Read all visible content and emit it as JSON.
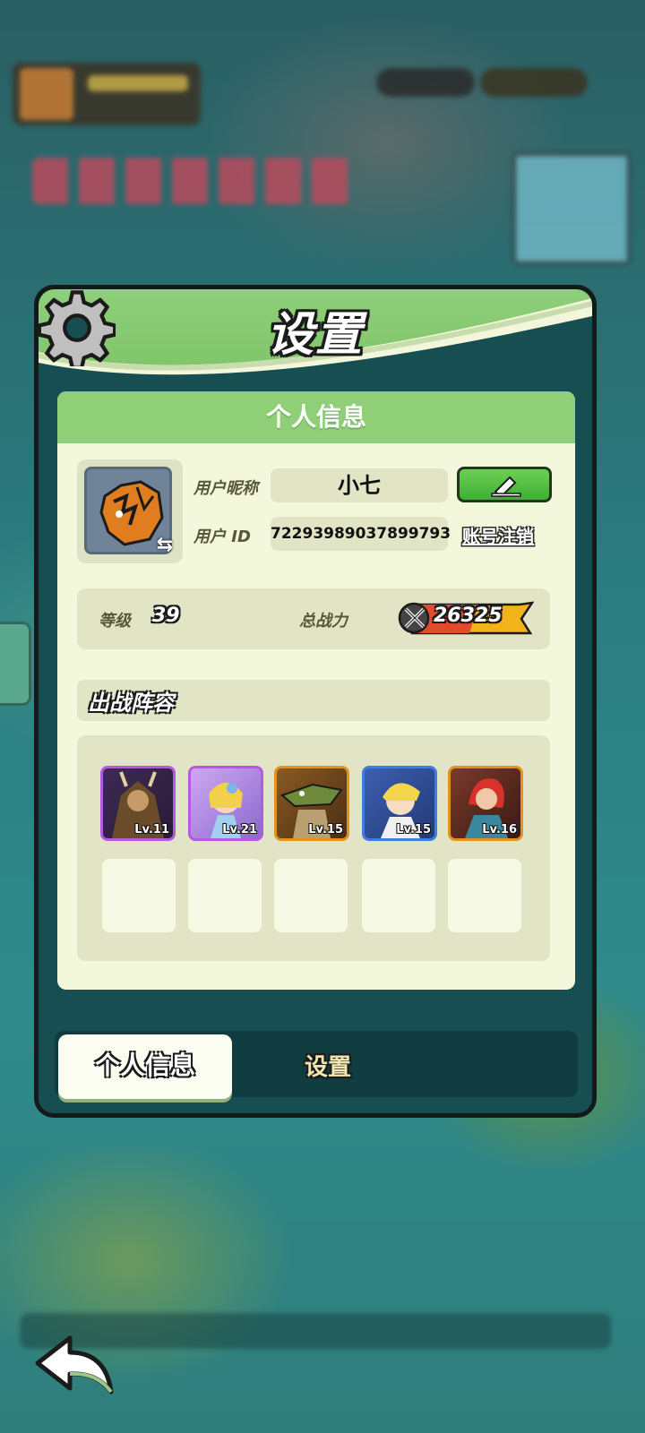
{
  "panel": {
    "title": "设置"
  },
  "profile": {
    "section_title": "个人信息",
    "nickname_label": "用户昵称",
    "nickname": "小七",
    "id_label": "用户 ID",
    "user_id": "72293989037899793",
    "delete_account": "账号注销",
    "level_label": "等级",
    "level": "39",
    "power_label": "总战力",
    "power": "26325"
  },
  "lineup": {
    "title": "出战阵容",
    "heroes": [
      {
        "level": "Lv.11",
        "rarity_color": "#b45ae0"
      },
      {
        "level": "Lv.21",
        "rarity_color": "#b45ae0"
      },
      {
        "level": "Lv.15",
        "rarity_color": "#e0941f"
      },
      {
        "level": "Lv.15",
        "rarity_color": "#3f7de0"
      },
      {
        "level": "Lv.16",
        "rarity_color": "#e0941f"
      }
    ],
    "empty_slots": 5
  },
  "tabs": {
    "profile": "个人信息",
    "settings": "设置"
  },
  "colors": {
    "panel_green": "#8ecf79",
    "panel_dark": "#174e52",
    "card_bg": "#f3f8dc"
  }
}
